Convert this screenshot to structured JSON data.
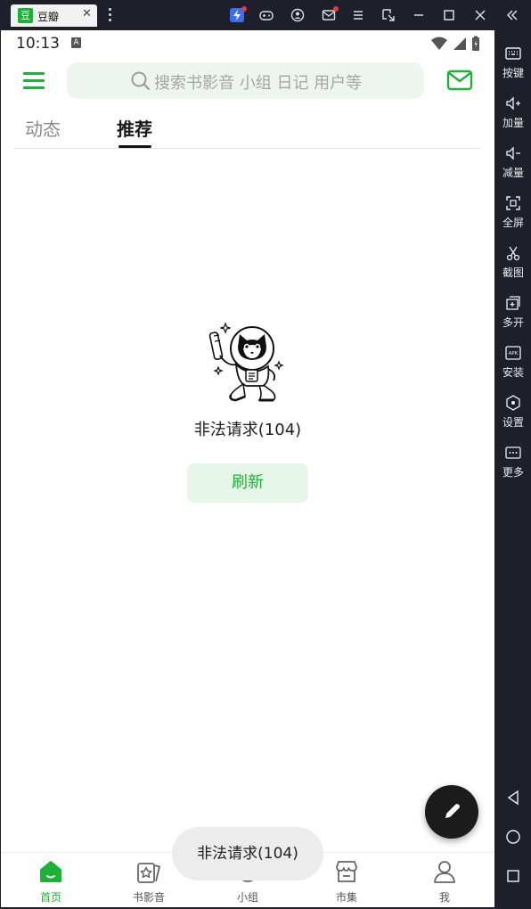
{
  "window": {
    "tab_logo": "豆",
    "tab_title": "豆瓣",
    "tab_close": "✕",
    "icons": [
      "lightning-app-icon",
      "gamepad-icon",
      "account-icon",
      "mail-icon",
      "menu-icon",
      "screenshot-icon",
      "minimize-icon",
      "maximize-icon",
      "close-icon",
      "collapse-icon"
    ]
  },
  "sidebar": {
    "items": [
      {
        "label": "按键",
        "icon": "keyboard-icon"
      },
      {
        "label": "加量",
        "icon": "volume-up-icon"
      },
      {
        "label": "减量",
        "icon": "volume-down-icon"
      },
      {
        "label": "全屏",
        "icon": "fullscreen-icon"
      },
      {
        "label": "截图",
        "icon": "scissors-icon"
      },
      {
        "label": "多开",
        "icon": "multi-instance-icon"
      },
      {
        "label": "安装",
        "icon": "apk-install-icon"
      },
      {
        "label": "设置",
        "icon": "settings-icon"
      },
      {
        "label": "更多",
        "icon": "more-icon"
      }
    ],
    "nav": [
      "back-icon",
      "home-icon",
      "recents-icon"
    ]
  },
  "status_bar": {
    "time": "10:13",
    "badge": "A"
  },
  "header": {
    "search_placeholder": "搜索书影音 小组 日记 用户等"
  },
  "tabs": [
    {
      "label": "动态",
      "active": false
    },
    {
      "label": "推荐",
      "active": true
    }
  ],
  "content": {
    "error_message": "非法请求(104)",
    "refresh_label": "刷新"
  },
  "toast": {
    "message": "非法请求(104)"
  },
  "bottom_nav": [
    {
      "label": "首页",
      "icon": "home-icon",
      "active": true
    },
    {
      "label": "书影音",
      "icon": "star-card-icon",
      "active": false
    },
    {
      "label": "小组",
      "icon": "group-icon",
      "active": false
    },
    {
      "label": "市集",
      "icon": "shop-icon",
      "active": false
    },
    {
      "label": "我",
      "icon": "profile-icon",
      "active": false
    }
  ],
  "colors": {
    "accent": "#1eb137",
    "refresh_bg": "#e6f6e9",
    "search_bg": "#eef5ef",
    "emulator_bg": "#1f1f2b"
  }
}
